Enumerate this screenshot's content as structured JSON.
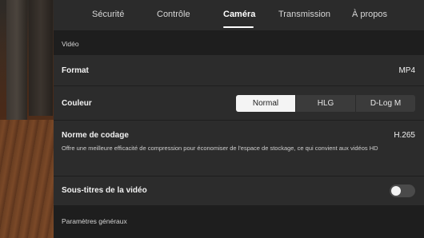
{
  "tabs": [
    {
      "label": "Sécurité"
    },
    {
      "label": "Contrôle"
    },
    {
      "label": "Caméra"
    },
    {
      "label": "Transmission"
    },
    {
      "label": "À propos"
    }
  ],
  "active_tab": "Caméra",
  "video_section": {
    "title": "Vidéo"
  },
  "format": {
    "label": "Format",
    "value": "MP4"
  },
  "color": {
    "label": "Couleur",
    "options": [
      "Normal",
      "HLG",
      "D-Log M"
    ],
    "selected": "Normal"
  },
  "codec": {
    "label": "Norme de codage",
    "value": "H.265",
    "description": "Offre une meilleure efficacité de compression pour économiser de l'espace de stockage, ce qui convient aux vidéos HD"
  },
  "subtitles": {
    "label": "Sous-titres de la vidéo",
    "enabled": false
  },
  "general_section": {
    "title": "Paramètres généraux"
  }
}
